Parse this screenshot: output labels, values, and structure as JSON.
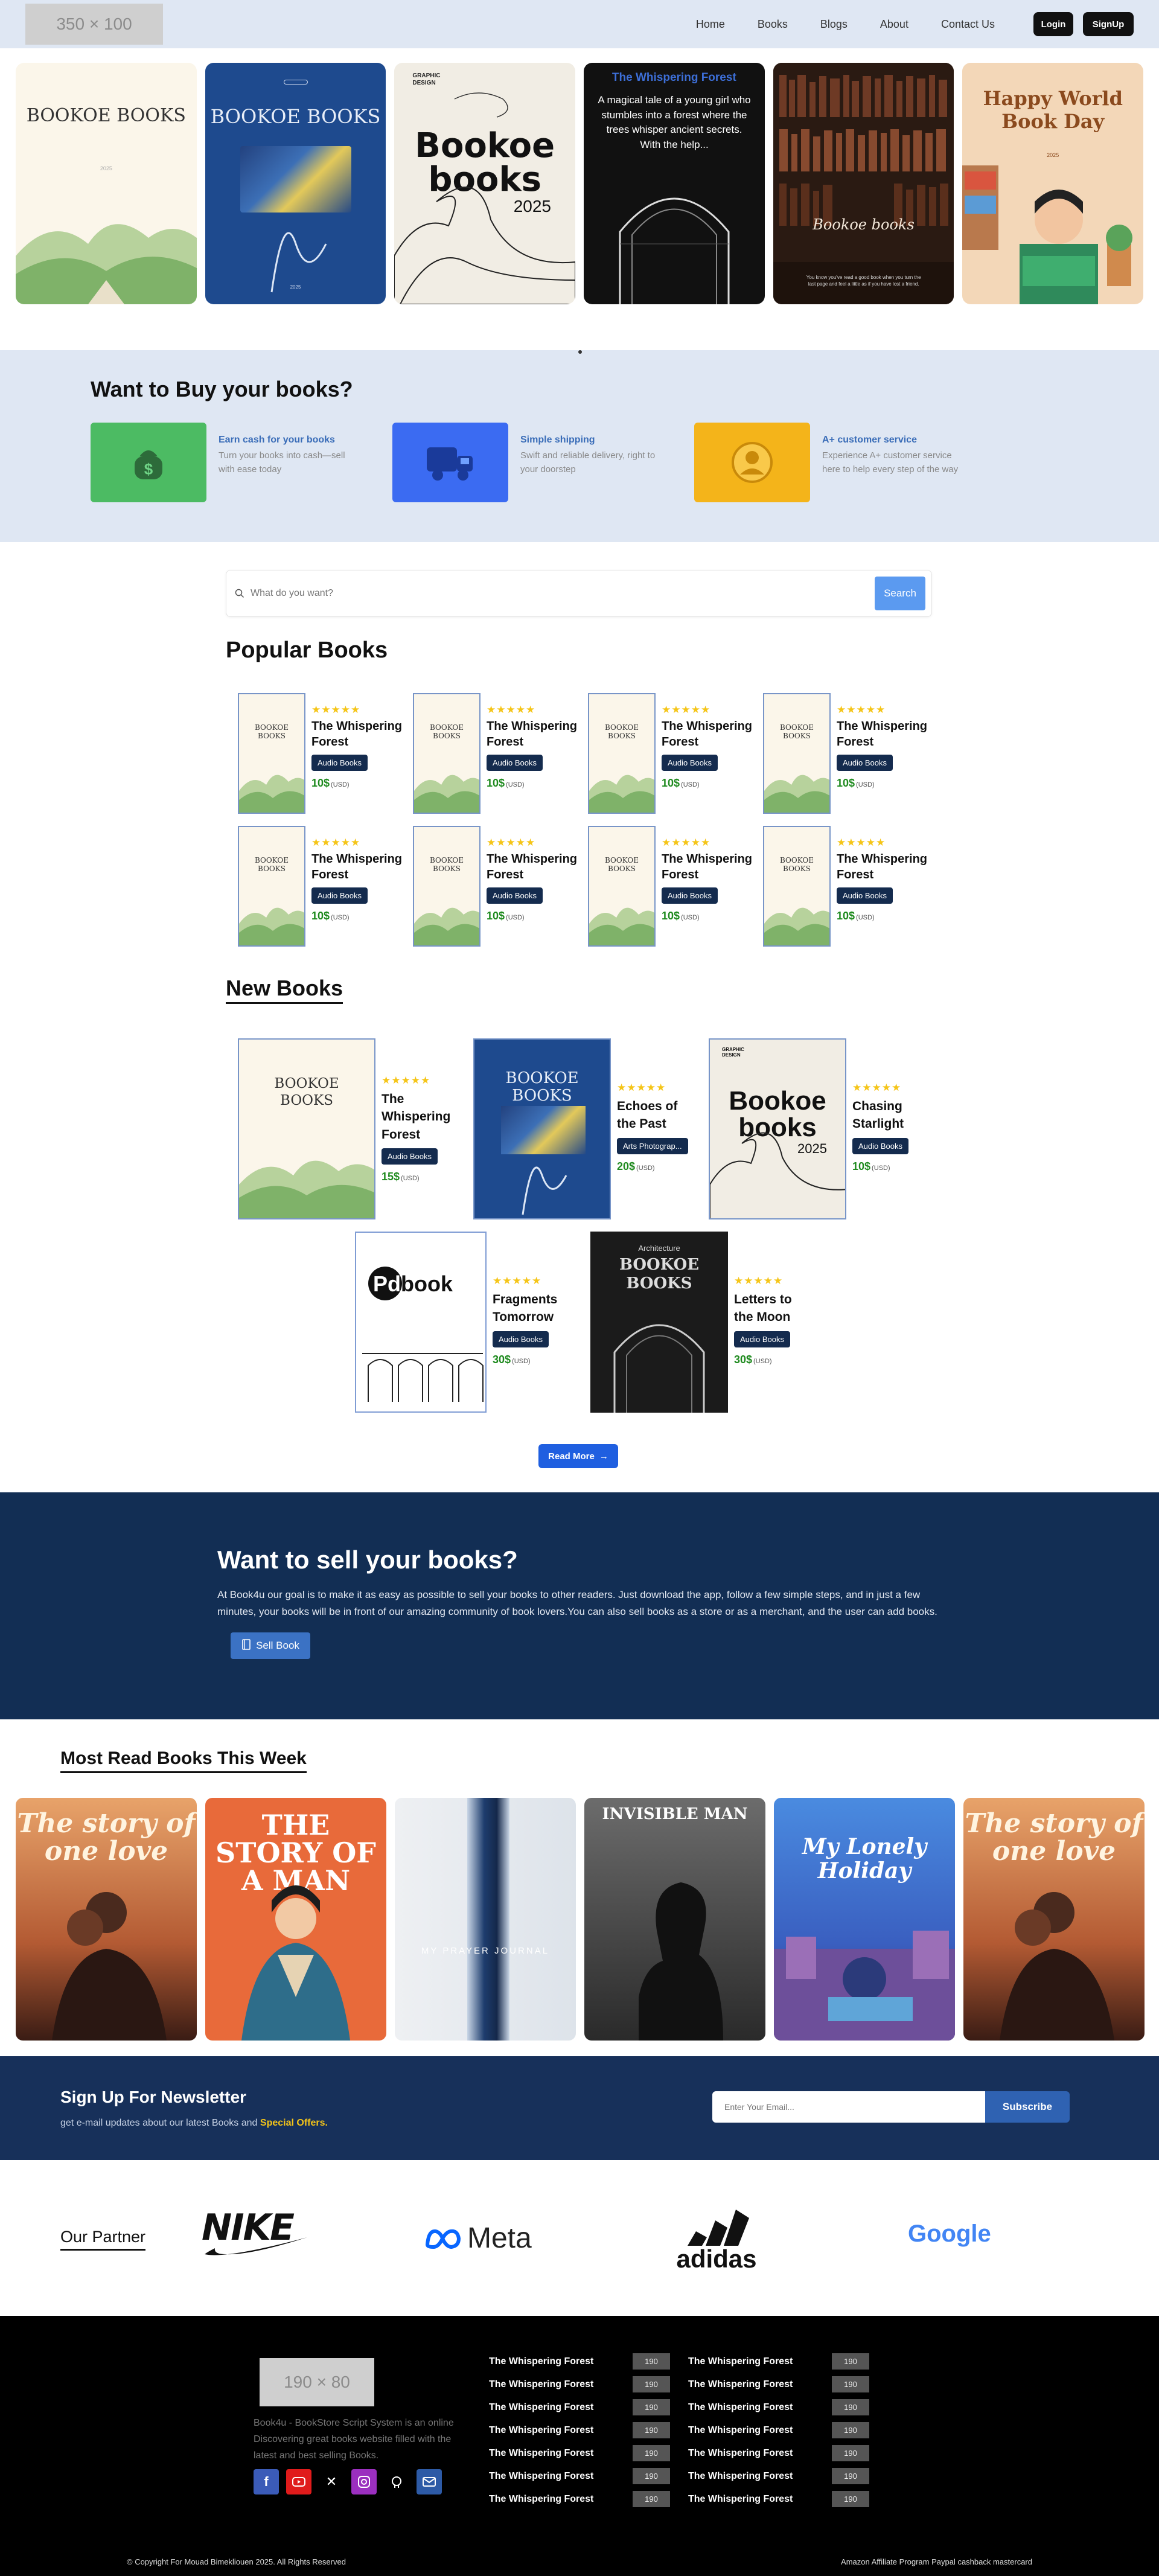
{
  "nav": {
    "logo_placeholder": "350 × 100",
    "links": [
      "Home",
      "Books",
      "Blogs",
      "About",
      "Contact Us"
    ],
    "login": "Login",
    "signup": "SignUp"
  },
  "hero": {
    "cards": [
      {
        "title": "BOOKOE BOOKS",
        "sub": "2025"
      },
      {
        "title": "BOOKOE BOOKS",
        "sub": "2025"
      },
      {
        "top": "GRAPHIC DESIGN",
        "title": "Bookoe books",
        "sub": "2025"
      },
      {
        "title": "The Whispering Forest",
        "text": "A magical tale of a young girl who stumbles into a forest where the trees whisper ancient secrets. With the help..."
      },
      {
        "title": "Bookoe books",
        "text": "You know you've read a good book when you turn the last page and feel a little as if you have lost a friend."
      },
      {
        "title": "Happy World Book Day",
        "sub": "2025"
      }
    ]
  },
  "buy": {
    "title": "Want to Buy your books?",
    "features": [
      {
        "icon": "money-bag-icon",
        "title": "Earn cash for your books",
        "text": "Turn your books into cash—sell with ease today",
        "color": "#4cbb63"
      },
      {
        "icon": "truck-icon",
        "title": "Simple shipping",
        "text": "Swift and reliable delivery, right to your doorstep",
        "color": "#3b6bf2"
      },
      {
        "icon": "customer-icon",
        "title": "A+ customer service",
        "text": "Experience A+ customer service here to help every step of the way",
        "color": "#f4b41a"
      }
    ]
  },
  "search": {
    "placeholder": "What do you want?",
    "button": "Search"
  },
  "popular": {
    "title": "Popular Books",
    "books": [
      {
        "stars": "★★★★★",
        "title": "The Whispering Forest",
        "tag": "Audio Books",
        "price": "10$",
        "unit": "(USD)"
      },
      {
        "stars": "★★★★★",
        "title": "The Whispering Forest",
        "tag": "Audio Books",
        "price": "10$",
        "unit": "(USD)"
      },
      {
        "stars": "★★★★★",
        "title": "The Whispering Forest",
        "tag": "Audio Books",
        "price": "10$",
        "unit": "(USD)"
      },
      {
        "stars": "★★★★★",
        "title": "The Whispering Forest",
        "tag": "Audio Books",
        "price": "10$",
        "unit": "(USD)"
      },
      {
        "stars": "★★★★★",
        "title": "The Whispering Forest",
        "tag": "Audio Books",
        "price": "10$",
        "unit": "(USD)"
      },
      {
        "stars": "★★★★★",
        "title": "The Whispering Forest",
        "tag": "Audio Books",
        "price": "10$",
        "unit": "(USD)"
      },
      {
        "stars": "★★★★★",
        "title": "The Whispering Forest",
        "tag": "Audio Books",
        "price": "10$",
        "unit": "(USD)"
      },
      {
        "stars": "★★★★★",
        "title": "The Whispering Forest",
        "tag": "Audio Books",
        "price": "10$",
        "unit": "(USD)"
      }
    ]
  },
  "new_books": {
    "title": "New Books",
    "books": [
      {
        "stars": "★★★★★",
        "title": "The Whispering Forest",
        "tag": "Audio Books",
        "price": "15$",
        "unit": "(USD)"
      },
      {
        "stars": "★★★★★",
        "title": "Echoes of the Past",
        "tag": "Arts Photograp...",
        "price": "20$",
        "unit": "(USD)"
      },
      {
        "stars": "★★★★★",
        "title": "Chasing Starlight",
        "tag": "Audio Books",
        "price": "10$",
        "unit": "(USD)"
      },
      {
        "stars": "★★★★★",
        "title": "Fragments Tomorrow",
        "tag": "Audio Books",
        "price": "30$",
        "unit": "(USD)"
      },
      {
        "stars": "★★★★★",
        "title": "Letters to the Moon",
        "tag": "Audio Books",
        "price": "30$",
        "unit": "(USD)"
      }
    ],
    "read_more": "Read More"
  },
  "sell": {
    "title": "Want to sell your books?",
    "text": "At Book4u our goal is to make it as easy as possible to sell your books to other readers. Just download the app, follow a few simple steps, and in just a few minutes, your books will be in front of our amazing community of book lovers.You can also sell books as a store or as a merchant, and the user can add books.",
    "button": "Sell Book"
  },
  "most_read": {
    "title": "Most Read Books This Week",
    "books": [
      "The story of one love",
      "THE STORY OF A MAN",
      "MY PRAYER JOURNAL",
      "INVISIBLE MAN",
      "My Lonely Holiday",
      "The story of one love"
    ]
  },
  "newsletter": {
    "title": "Sign Up For Newsletter",
    "text": "get e-mail updates about our latest Books and",
    "highlight": "Special Offers.",
    "placeholder": "Enter Your Email...",
    "button": "Subscribe"
  },
  "partners": {
    "title": "Our Partner",
    "logos": [
      "NIKE",
      "Meta",
      "adidas",
      "Google"
    ]
  },
  "footer": {
    "logo_placeholder": "190 × 80",
    "desc": "Book4u - BookStore Script System is an online Discovering great books website filled with the latest and best selling Books.",
    "links_left": [
      {
        "label": "The Whispering Forest",
        "count": "190"
      },
      {
        "label": "The Whispering Forest",
        "count": "190"
      },
      {
        "label": "The Whispering Forest",
        "count": "190"
      },
      {
        "label": "The Whispering Forest",
        "count": "190"
      },
      {
        "label": "The Whispering Forest",
        "count": "190"
      },
      {
        "label": "The Whispering Forest",
        "count": "190"
      },
      {
        "label": "The Whispering Forest",
        "count": "190"
      }
    ],
    "links_right": [
      {
        "label": "The Whispering Forest",
        "count": "190"
      },
      {
        "label": "The Whispering Forest",
        "count": "190"
      },
      {
        "label": "The Whispering Forest",
        "count": "190"
      },
      {
        "label": "The Whispering Forest",
        "count": "190"
      },
      {
        "label": "The Whispering Forest",
        "count": "190"
      },
      {
        "label": "The Whispering Forest",
        "count": "190"
      },
      {
        "label": "The Whispering Forest",
        "count": "190"
      }
    ],
    "copyright": "© Copyright For Mouad Bimekliouen 2025. All Rights Reserved",
    "payments": "Amazon Affiliate Program Paypal cashback mastercard"
  }
}
